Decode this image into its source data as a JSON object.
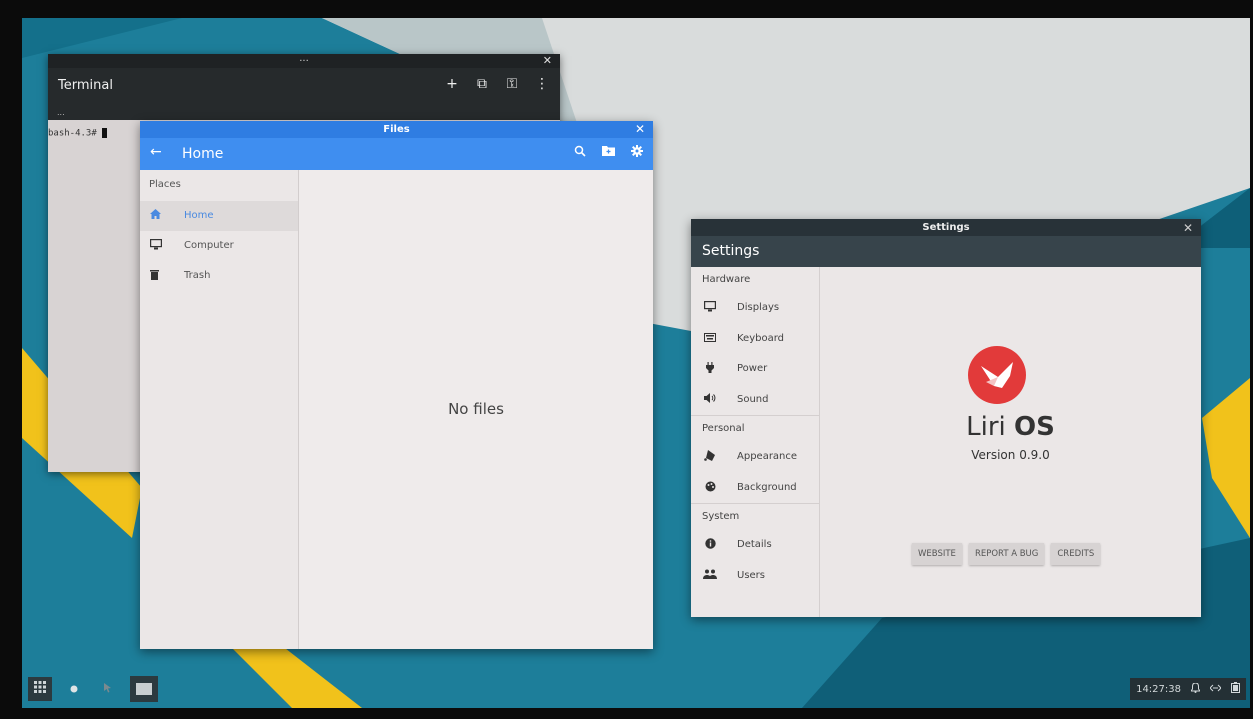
{
  "terminal": {
    "titlebar_text": "...",
    "close_glyph": "✕",
    "title": "Terminal",
    "tab_indicator": "...",
    "prompt": "bash-4.3# ",
    "actions": [
      "+",
      "⧉",
      "⚿",
      "⋮"
    ]
  },
  "files": {
    "window_title": "Files",
    "close_glyph": "✕",
    "back_glyph": "←",
    "location": "Home",
    "places_heading": "Places",
    "places": [
      {
        "label": "Home",
        "icon": "home-icon",
        "selected": true
      },
      {
        "label": "Computer",
        "icon": "computer-icon",
        "selected": false
      },
      {
        "label": "Trash",
        "icon": "trash-icon",
        "selected": false
      }
    ],
    "empty_text": "No files"
  },
  "settings": {
    "window_title": "Settings",
    "close_glyph": "✕",
    "title": "Settings",
    "sections": [
      {
        "heading": "Hardware",
        "items": [
          {
            "label": "Displays",
            "icon": "display-icon"
          },
          {
            "label": "Keyboard",
            "icon": "keyboard-icon"
          },
          {
            "label": "Power",
            "icon": "power-icon"
          },
          {
            "label": "Sound",
            "icon": "sound-icon"
          }
        ]
      },
      {
        "heading": "Personal",
        "items": [
          {
            "label": "Appearance",
            "icon": "appearance-icon"
          },
          {
            "label": "Background",
            "icon": "palette-icon"
          }
        ]
      },
      {
        "heading": "System",
        "items": [
          {
            "label": "Details",
            "icon": "info-icon"
          },
          {
            "label": "Users",
            "icon": "users-icon"
          }
        ]
      }
    ],
    "os_name_light": "Liri ",
    "os_name_bold": "OS",
    "version": "Version 0.9.0",
    "buttons": {
      "website": "WEBSITE",
      "report_bug": "REPORT A BUG",
      "credits": "CREDITS"
    }
  },
  "panel": {
    "time": "14:27:38"
  },
  "colors": {
    "files_accent": "#3f8ef0",
    "settings_header": "#37444b",
    "liri_red": "#e23a3a",
    "wallpaper_teal": "#1d7e9a",
    "wallpaper_yellow": "#f1c21b"
  }
}
